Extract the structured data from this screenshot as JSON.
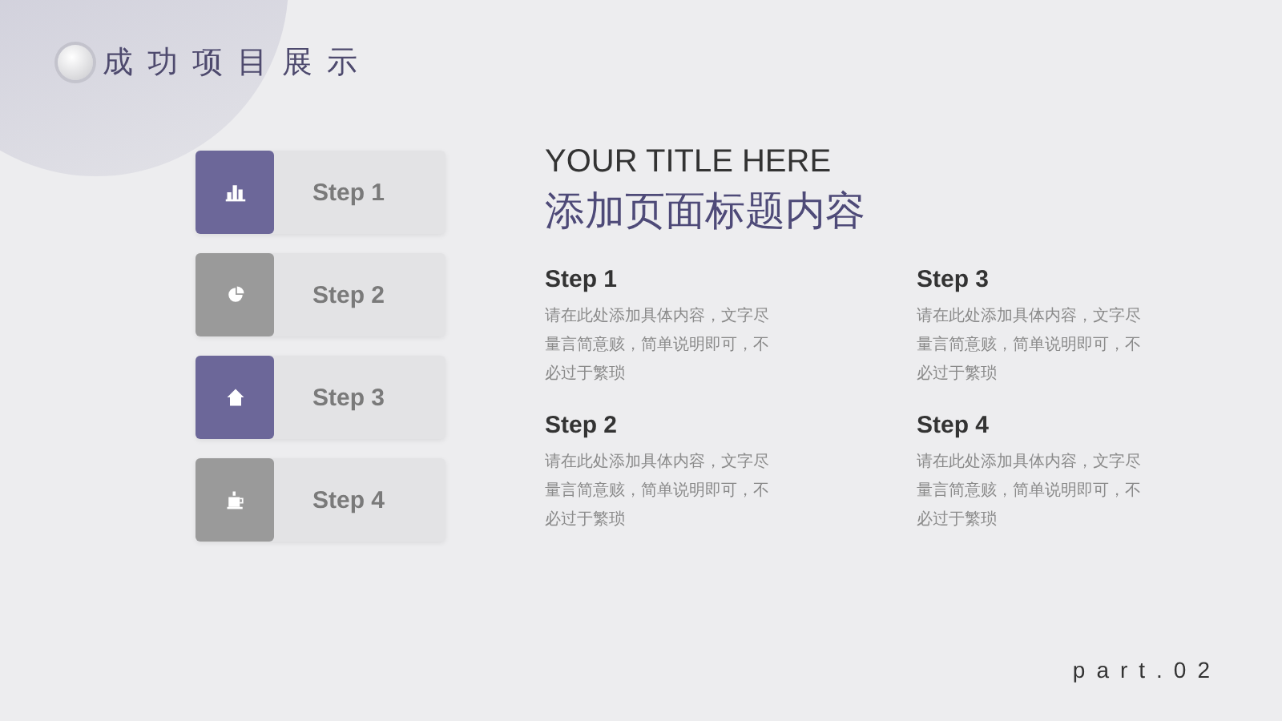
{
  "header": {
    "title": "成功项目展示"
  },
  "steps": [
    {
      "label": "Step 1",
      "kind": "chart",
      "color": "#6c6799"
    },
    {
      "label": "Step 2",
      "kind": "pie",
      "color": "#9a9a9a"
    },
    {
      "label": "Step 3",
      "kind": "home",
      "color": "#6c6799"
    },
    {
      "label": "Step 4",
      "kind": "cup",
      "color": "#9a9a9a"
    }
  ],
  "content": {
    "subtitle": "YOUR TITLE HERE",
    "title": "添加页面标题内容",
    "items": [
      {
        "heading": "Step 1",
        "text": "请在此处添加具体内容，文字尽量言简意赅，简单说明即可，不必过于繁琐"
      },
      {
        "heading": "Step 3",
        "text": "请在此处添加具体内容，文字尽量言简意赅，简单说明即可，不必过于繁琐"
      },
      {
        "heading": "Step 2",
        "text": "请在此处添加具体内容，文字尽量言简意赅，简单说明即可，不必过于繁琐"
      },
      {
        "heading": "Step 4",
        "text": "请在此处添加具体内容，文字尽量言简意赅，简单说明即可，不必过于繁琐"
      }
    ]
  },
  "footer": {
    "page": "part.02"
  }
}
